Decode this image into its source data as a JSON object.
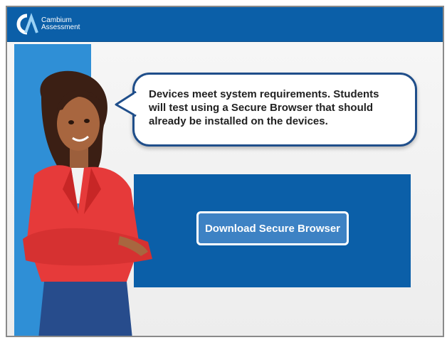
{
  "header": {
    "brand_line1": "Cambium",
    "brand_line2": "Assessment",
    "logo_letters": "CA"
  },
  "bubble": {
    "text": "Devices meet system requirements. Students will test using a Secure Browser that should already be installed on the devices."
  },
  "panel": {
    "download_label": "Download Secure Browser"
  },
  "colors": {
    "header": "#0b5fa8",
    "panel": "#0b5fa8",
    "side_band": "#2f8fd6",
    "bubble_border": "#1f4e8a",
    "button": "#3d82c4"
  }
}
